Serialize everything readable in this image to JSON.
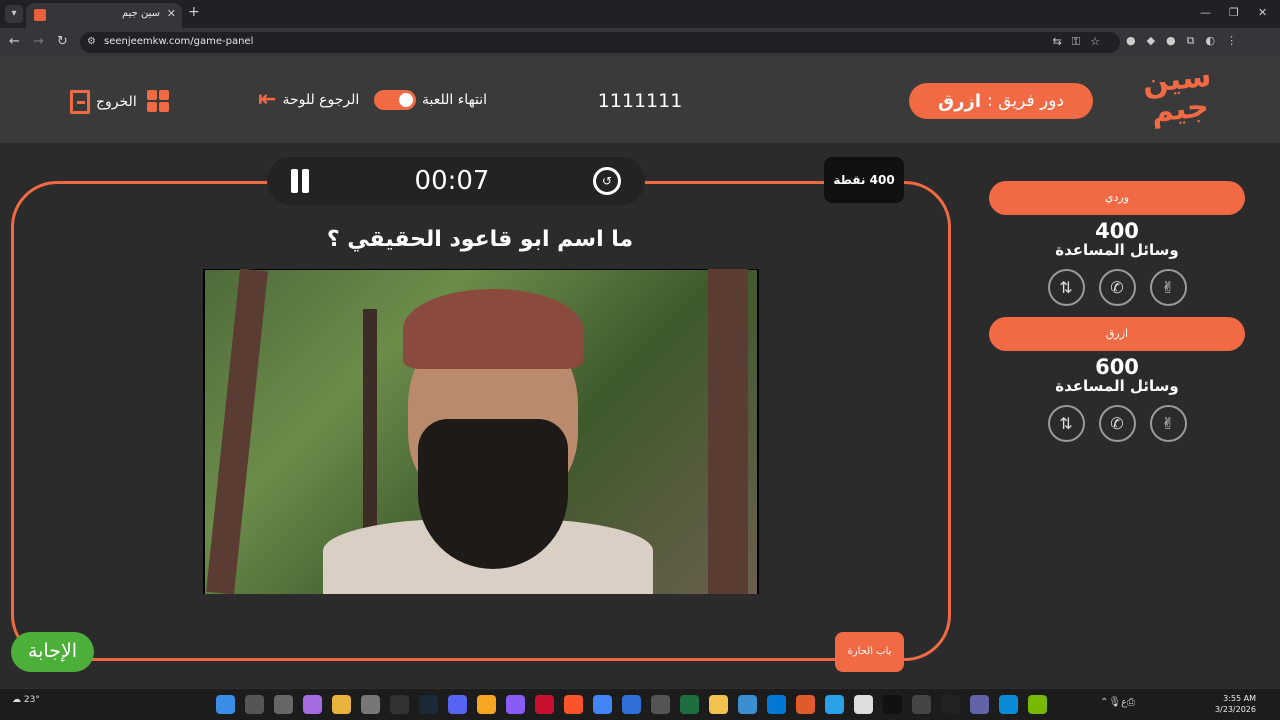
{
  "browser": {
    "tab_title": "سين جيم",
    "url": "seenjeemkw.com/game-panel"
  },
  "header": {
    "logo_text": "سين جيم",
    "turn_label": "دور فريق :",
    "turn_team": "ازرق",
    "game_code": "1111111",
    "end_game_label": "انتهاء اللعبة",
    "back_to_board_label": "الرجوع للوحة",
    "exit_label": "الخروج"
  },
  "question": {
    "timer": "00:07",
    "points_badge": "400 نقطة",
    "text": "ما اسم ابو قاعود الحقيقي ؟",
    "answer_button": "الإجابة",
    "category": "باب الحارة"
  },
  "teams": [
    {
      "name": "وردي",
      "score": "400",
      "aids_label": "وسائل المساعدة"
    },
    {
      "name": "ازرق",
      "score": "600",
      "aids_label": "وسائل المساعدة"
    }
  ],
  "taskbar": {
    "weather": "23°",
    "time": "3:55 AM",
    "date": "3/23/2026"
  },
  "colors": {
    "accent": "#f26a44",
    "answer_green": "#4caf3a",
    "background": "#2b2b2b",
    "header_bg": "#3a3a3a"
  }
}
